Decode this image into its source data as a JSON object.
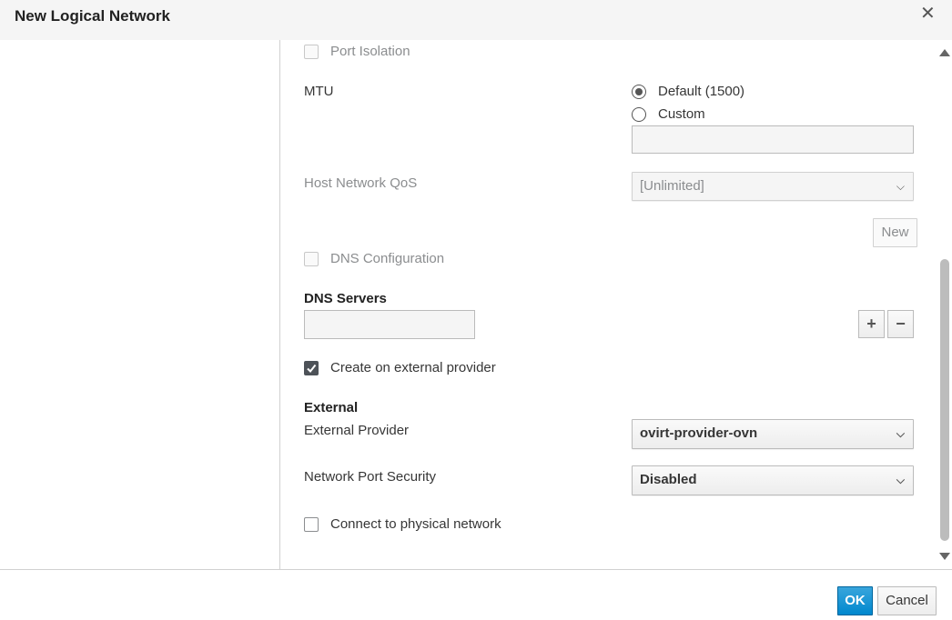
{
  "dialog": {
    "title": "New Logical Network"
  },
  "form": {
    "port_isolation": {
      "label": "Port Isolation",
      "checked": false,
      "disabled": true
    },
    "mtu": {
      "label": "MTU",
      "options": [
        "Default (1500)",
        "Custom"
      ],
      "selected": "Default (1500)",
      "custom_value": ""
    },
    "host_network_qos": {
      "label": "Host Network QoS",
      "value": "[Unlimited]",
      "new_button": "New"
    },
    "dns_configuration": {
      "label": "DNS Configuration",
      "checked": false,
      "disabled": true
    },
    "dns_servers": {
      "heading": "DNS Servers",
      "value": "",
      "add": "+",
      "remove": "−"
    },
    "create_external": {
      "label": "Create on external provider",
      "checked": true
    },
    "external": {
      "heading": "External",
      "provider_label": "External Provider",
      "provider_value": "ovirt-provider-ovn",
      "port_security_label": "Network Port Security",
      "port_security_value": "Disabled"
    },
    "connect_physical": {
      "label": "Connect to physical network",
      "checked": false
    }
  },
  "footer": {
    "ok": "OK",
    "cancel": "Cancel"
  },
  "colors": {
    "primary": "#0088ce",
    "header_bg": "#f5f5f5"
  }
}
